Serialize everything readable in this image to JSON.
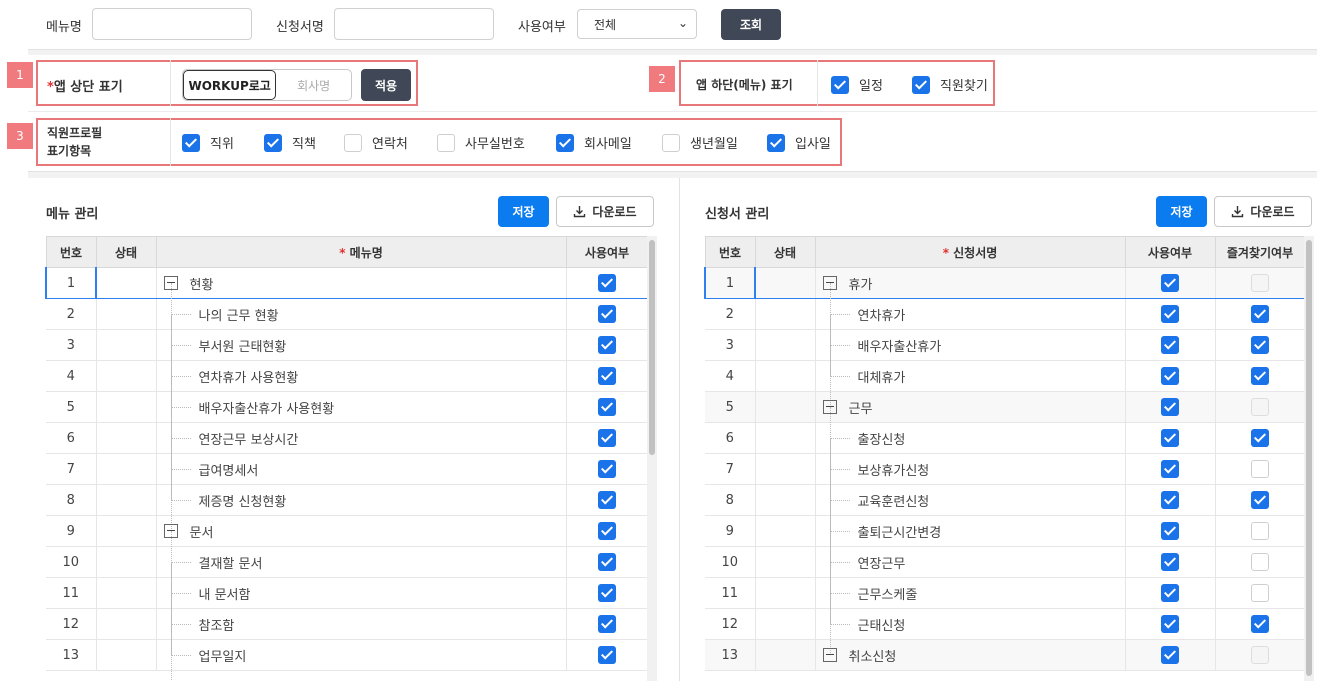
{
  "search": {
    "menu_label": "메뉴명",
    "menu_value": "",
    "form_label": "신청서명",
    "form_value": "",
    "use_label": "사용여부",
    "use_selected": "전체",
    "search_button": "조회"
  },
  "settings": {
    "top": {
      "tag": "1",
      "label": "*앱 상단 표기",
      "option_logo": "WORKUP로고",
      "option_company": "회사명",
      "apply_button": "적용"
    },
    "bottom": {
      "tag": "2",
      "label": "앱 하단(메뉴) 표기",
      "items": [
        {
          "label": "일정",
          "checked": true
        },
        {
          "label": "직원찾기",
          "checked": true
        }
      ]
    },
    "profile": {
      "tag": "3",
      "label_line1": "직원프로필",
      "label_line2": "표기항목",
      "items": [
        {
          "label": "직위",
          "checked": true
        },
        {
          "label": "직책",
          "checked": true
        },
        {
          "label": "연락처",
          "checked": false
        },
        {
          "label": "사무실번호",
          "checked": false
        },
        {
          "label": "회사메일",
          "checked": true
        },
        {
          "label": "생년월일",
          "checked": false
        },
        {
          "label": "입사일",
          "checked": true
        }
      ]
    }
  },
  "menu_panel": {
    "title": "메뉴 관리",
    "save_button": "저장",
    "download_button": "다운로드",
    "columns": {
      "no": "번호",
      "status": "상태",
      "name": "메뉴명",
      "use": "사용여부"
    },
    "rows": [
      {
        "no": "1",
        "name": "현황",
        "level": 0,
        "use": true
      },
      {
        "no": "2",
        "name": "나의 근무 현황",
        "level": 1,
        "use": true
      },
      {
        "no": "3",
        "name": "부서원 근태현황",
        "level": 1,
        "use": true
      },
      {
        "no": "4",
        "name": "연차휴가 사용현황",
        "level": 1,
        "use": true
      },
      {
        "no": "5",
        "name": "배우자출산휴가 사용현황",
        "level": 1,
        "use": true
      },
      {
        "no": "6",
        "name": "연장근무 보상시간",
        "level": 1,
        "use": true
      },
      {
        "no": "7",
        "name": "급여명세서",
        "level": 1,
        "use": true
      },
      {
        "no": "8",
        "name": "제증명 신청현황",
        "level": 1,
        "use": true
      },
      {
        "no": "9",
        "name": "문서",
        "level": 0,
        "use": true
      },
      {
        "no": "10",
        "name": "결재할 문서",
        "level": 1,
        "use": true
      },
      {
        "no": "11",
        "name": "내 문서함",
        "level": 1,
        "use": true
      },
      {
        "no": "12",
        "name": "참조함",
        "level": 1,
        "use": true
      },
      {
        "no": "13",
        "name": "업무일지",
        "level": 1,
        "use": true
      }
    ]
  },
  "form_panel": {
    "title": "신청서 관리",
    "save_button": "저장",
    "download_button": "다운로드",
    "columns": {
      "no": "번호",
      "status": "상태",
      "name": "신청서명",
      "use": "사용여부",
      "fav": "즐겨찾기여부"
    },
    "rows": [
      {
        "no": "1",
        "name": "휴가",
        "level": 0,
        "use": true,
        "fav": "disabled"
      },
      {
        "no": "2",
        "name": "연차휴가",
        "level": 1,
        "use": true,
        "fav": "on"
      },
      {
        "no": "3",
        "name": "배우자출산휴가",
        "level": 1,
        "use": true,
        "fav": "on"
      },
      {
        "no": "4",
        "name": "대체휴가",
        "level": 1,
        "use": true,
        "fav": "on"
      },
      {
        "no": "5",
        "name": "근무",
        "level": 0,
        "use": true,
        "fav": "disabled"
      },
      {
        "no": "6",
        "name": "출장신청",
        "level": 1,
        "use": true,
        "fav": "on"
      },
      {
        "no": "7",
        "name": "보상휴가신청",
        "level": 1,
        "use": true,
        "fav": "off"
      },
      {
        "no": "8",
        "name": "교육훈련신청",
        "level": 1,
        "use": true,
        "fav": "on"
      },
      {
        "no": "9",
        "name": "출퇴근시간변경",
        "level": 1,
        "use": true,
        "fav": "off"
      },
      {
        "no": "10",
        "name": "연장근무",
        "level": 1,
        "use": true,
        "fav": "off"
      },
      {
        "no": "11",
        "name": "근무스케줄",
        "level": 1,
        "use": true,
        "fav": "off"
      },
      {
        "no": "12",
        "name": "근태신청",
        "level": 1,
        "use": true,
        "fav": "on"
      },
      {
        "no": "13",
        "name": "취소신청",
        "level": 0,
        "use": true,
        "fav": "disabled"
      }
    ]
  }
}
